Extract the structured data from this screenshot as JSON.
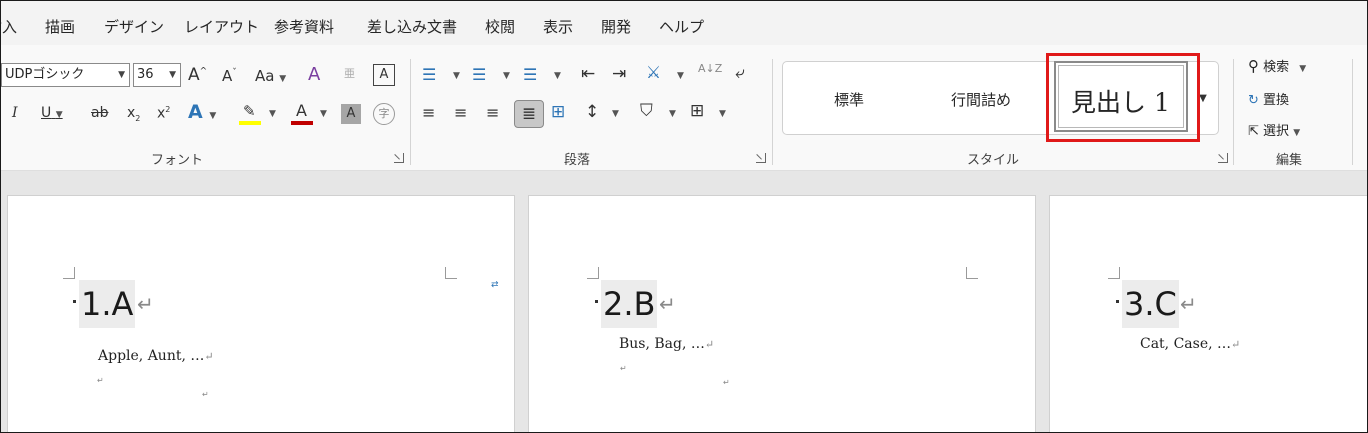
{
  "menu": {
    "items": [
      "挿入",
      "描画",
      "デザイン",
      "レイアウト",
      "参考資料",
      "差し込み文書",
      "校閲",
      "表示",
      "開発",
      "ヘルプ"
    ]
  },
  "font_group": {
    "font_name": "UDPゴシック",
    "font_size": "36",
    "grow_label": "A",
    "shrink_label": "A",
    "case_label": "Aa",
    "ruby_label": "亜",
    "border_char_label": "A",
    "italic_label": "I",
    "underline_label": "U",
    "strike_label": "ab",
    "subscript_label": "x",
    "superscript_label": "x",
    "effects_label": "A",
    "font_color_label": "A",
    "shading_label": "A",
    "enclose_label": "字",
    "label": "フォント",
    "highlight_color": "#ffff00",
    "font_color": "#c00000"
  },
  "paragraph_group": {
    "sort_label": "A↓Z",
    "label": "段落"
  },
  "styles_group": {
    "items": [
      "標準",
      "行間詰め",
      "見出し 1"
    ],
    "label": "スタイル"
  },
  "editing_group": {
    "find_label": "検索",
    "replace_label": "置換",
    "select_label": "選択",
    "label": "編集"
  },
  "pages": [
    {
      "heading": "1.A",
      "body": "Apple, Aunt, …"
    },
    {
      "heading": "2.B",
      "body": "Bus, Bag, …"
    },
    {
      "heading": "3.C",
      "body": "Cat, Case, …"
    }
  ],
  "marks": {
    "paragraph": "↵"
  },
  "colors": {
    "accent_highlight": "#e01919",
    "ribbon_bg": "#f9f9f9",
    "menu_bg": "#f3f3f3",
    "doc_bg": "#e6e6e6"
  }
}
